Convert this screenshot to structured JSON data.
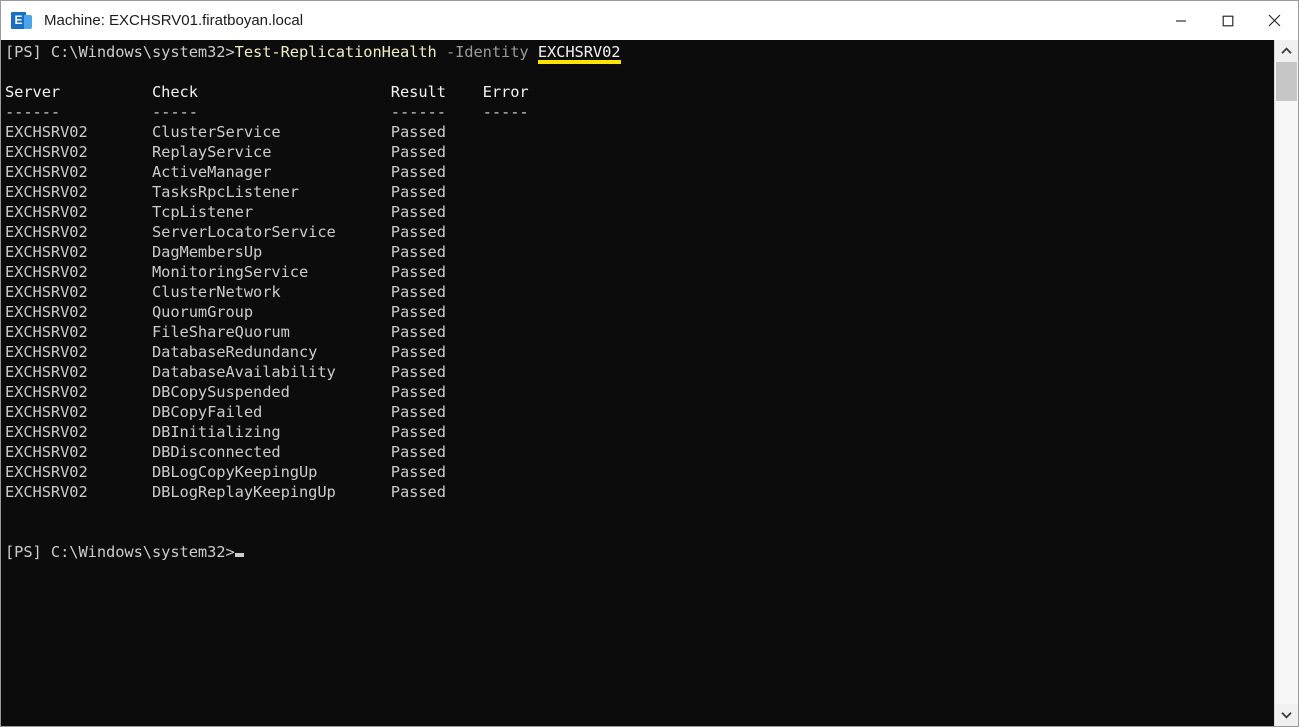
{
  "window": {
    "title": "Machine: EXCHSRV01.firatboyan.local",
    "app_icon": "exchange-icon",
    "icon_letter": "E",
    "controls": {
      "minimize": "minimize-icon",
      "maximize": "maximize-icon",
      "close": "close-icon"
    }
  },
  "colors": {
    "console_background": "#0C0C0C",
    "console_foreground": "#CCCCCC",
    "cmdlet": "#EEEDC4",
    "parameter": "#9A9A9A",
    "highlight_underline": "#FFE400",
    "titlebar_background": "#FFFFFF",
    "accent": "#1A6FC4"
  },
  "console": {
    "prompt": "[PS] C:\\Windows\\system32>",
    "command": {
      "cmdlet": "Test-ReplicationHealth",
      "parameter": "-Identity",
      "argument": "EXCHSRV02",
      "full_text": "[PS] C:\\Windows\\system32>Test-ReplicationHealth -Identity EXCHSRV02"
    },
    "table": {
      "headers": [
        "Server",
        "Check",
        "Result",
        "Error"
      ],
      "separators": [
        "------",
        "-----",
        "------",
        "-----"
      ],
      "column_starts": [
        0,
        16,
        42,
        52
      ],
      "rows": [
        {
          "server": "EXCHSRV02",
          "check": "ClusterService",
          "result": "Passed",
          "error": ""
        },
        {
          "server": "EXCHSRV02",
          "check": "ReplayService",
          "result": "Passed",
          "error": ""
        },
        {
          "server": "EXCHSRV02",
          "check": "ActiveManager",
          "result": "Passed",
          "error": ""
        },
        {
          "server": "EXCHSRV02",
          "check": "TasksRpcListener",
          "result": "Passed",
          "error": ""
        },
        {
          "server": "EXCHSRV02",
          "check": "TcpListener",
          "result": "Passed",
          "error": ""
        },
        {
          "server": "EXCHSRV02",
          "check": "ServerLocatorService",
          "result": "Passed",
          "error": ""
        },
        {
          "server": "EXCHSRV02",
          "check": "DagMembersUp",
          "result": "Passed",
          "error": ""
        },
        {
          "server": "EXCHSRV02",
          "check": "MonitoringService",
          "result": "Passed",
          "error": ""
        },
        {
          "server": "EXCHSRV02",
          "check": "ClusterNetwork",
          "result": "Passed",
          "error": ""
        },
        {
          "server": "EXCHSRV02",
          "check": "QuorumGroup",
          "result": "Passed",
          "error": ""
        },
        {
          "server": "EXCHSRV02",
          "check": "FileShareQuorum",
          "result": "Passed",
          "error": ""
        },
        {
          "server": "EXCHSRV02",
          "check": "DatabaseRedundancy",
          "result": "Passed",
          "error": ""
        },
        {
          "server": "EXCHSRV02",
          "check": "DatabaseAvailability",
          "result": "Passed",
          "error": ""
        },
        {
          "server": "EXCHSRV02",
          "check": "DBCopySuspended",
          "result": "Passed",
          "error": ""
        },
        {
          "server": "EXCHSRV02",
          "check": "DBCopyFailed",
          "result": "Passed",
          "error": ""
        },
        {
          "server": "EXCHSRV02",
          "check": "DBInitializing",
          "result": "Passed",
          "error": ""
        },
        {
          "server": "EXCHSRV02",
          "check": "DBDisconnected",
          "result": "Passed",
          "error": ""
        },
        {
          "server": "EXCHSRV02",
          "check": "DBLogCopyKeepingUp",
          "result": "Passed",
          "error": ""
        },
        {
          "server": "EXCHSRV02",
          "check": "DBLogReplayKeepingUp",
          "result": "Passed",
          "error": ""
        }
      ]
    },
    "trailing_prompt": "[PS] C:\\Windows\\system32>"
  },
  "scrollbar": {
    "up_arrow": "chevron-up-icon",
    "down_arrow": "chevron-down-icon",
    "thumb_position_percent": 0,
    "thumb_size_percent": 6
  }
}
